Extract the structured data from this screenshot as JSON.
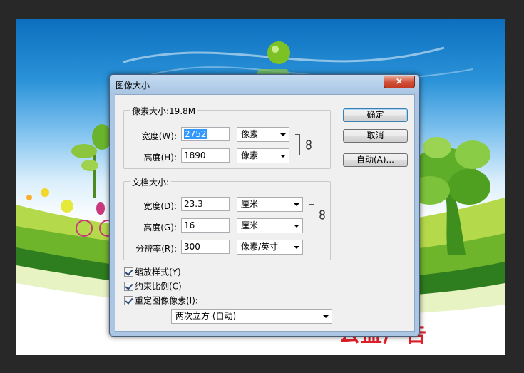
{
  "background": {
    "ad_text": "公益广告"
  },
  "dialog": {
    "title": "图像大小",
    "close_glyph": "×",
    "pixel_dimensions": {
      "group_title": "像素大小:19.8M",
      "width_label": "宽度(W):",
      "width_value": "2752",
      "width_unit": "像素",
      "height_label": "高度(H):",
      "height_value": "1890",
      "height_unit": "像素"
    },
    "document_size": {
      "group_title": "文档大小:",
      "width_label": "宽度(D):",
      "width_value": "23.3",
      "width_unit": "厘米",
      "height_label": "高度(G):",
      "height_value": "16",
      "height_unit": "厘米",
      "resolution_label": "分辨率(R):",
      "resolution_value": "300",
      "resolution_unit": "像素/英寸"
    },
    "buttons": {
      "ok": "确定",
      "cancel": "取消",
      "auto": "自动(A)..."
    },
    "options": {
      "scale_styles": "缩放样式(Y)",
      "constrain": "约束比例(C)",
      "resample": "重定图像像素(I):",
      "resample_method": "两次立方 (自动)"
    },
    "link_icon": "chain-link"
  }
}
